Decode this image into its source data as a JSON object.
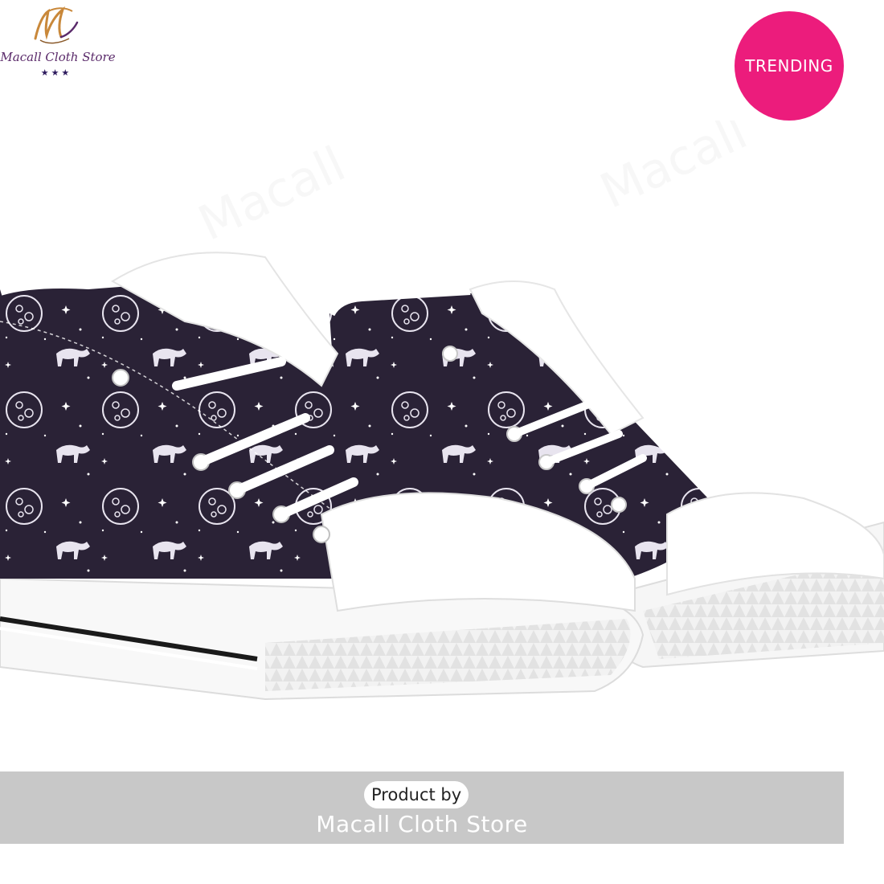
{
  "brand": {
    "logo_text": "Macall Cloth Store",
    "logo_stars": "★★★",
    "logo_colors": {
      "monogram": "#c9883a",
      "text": "#5a2a6a",
      "stars": "#2e1b5e"
    }
  },
  "badge": {
    "label": "TRENDING",
    "color": "#ec1c7c"
  },
  "product_image": {
    "subject": "high-top-sneakers",
    "upper_color": "#2a2236",
    "sole_color": "#ffffff"
  },
  "banner": {
    "product_by_label": "Product by",
    "store_name": "Macall Cloth Store",
    "background_color": "#c8c8c8"
  }
}
